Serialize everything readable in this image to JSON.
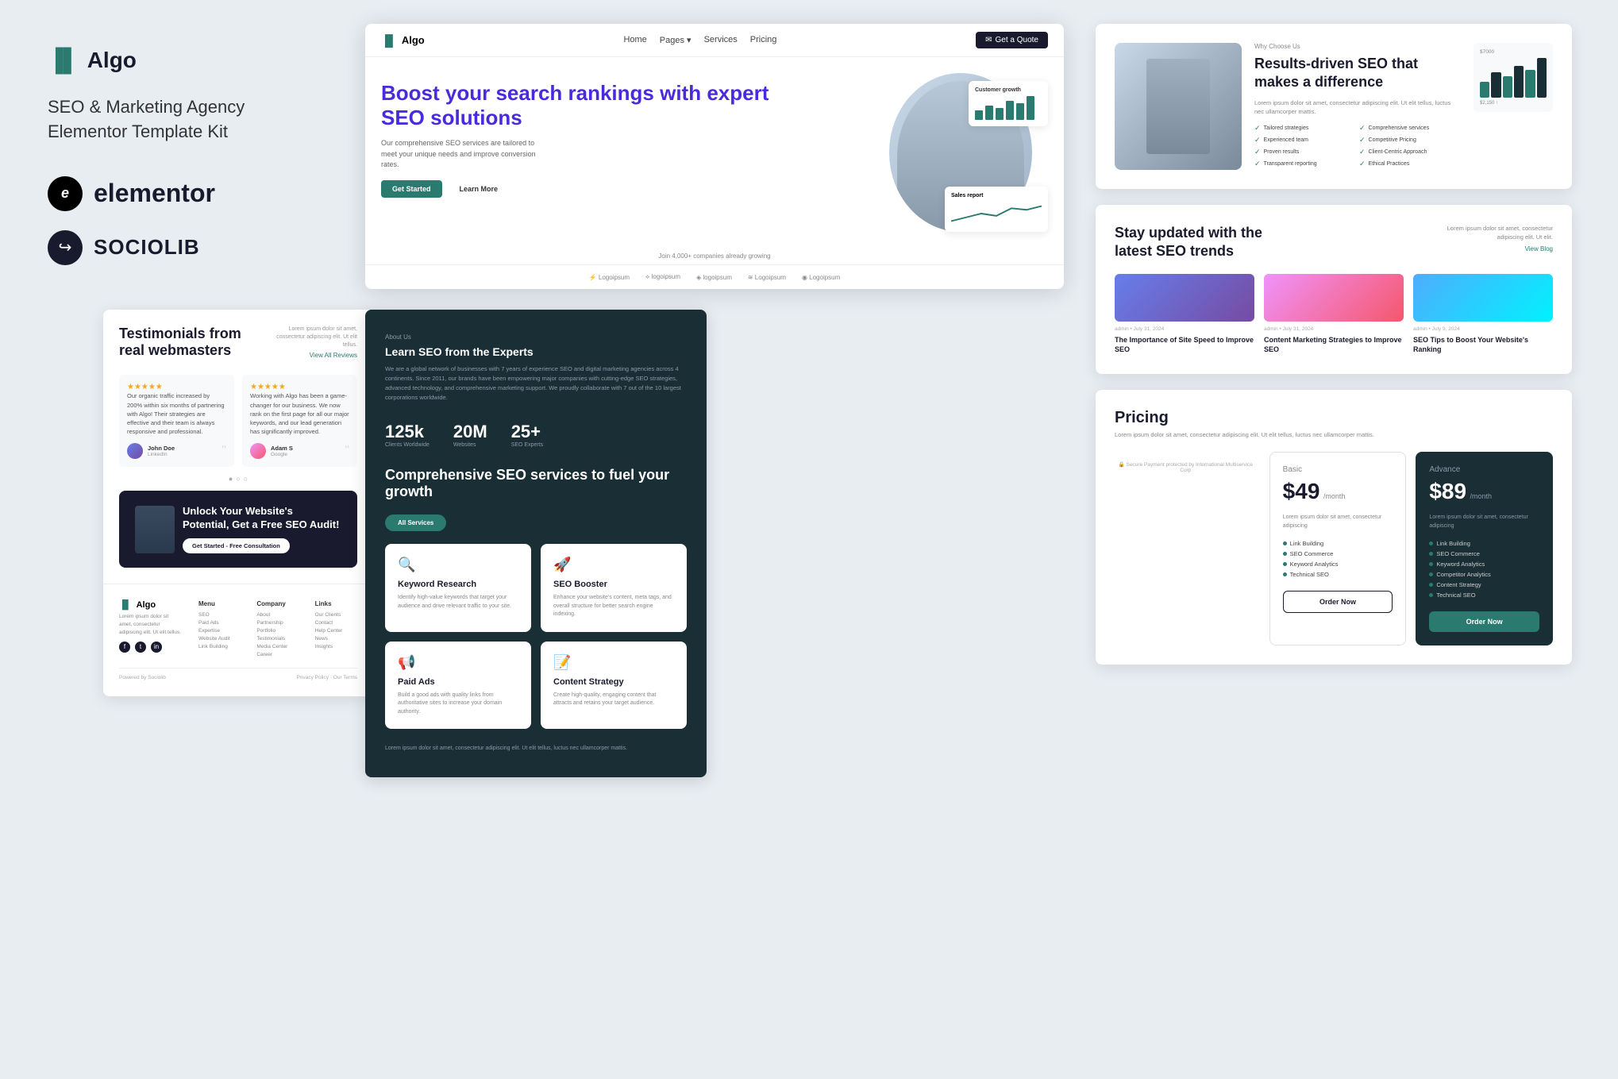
{
  "brand": {
    "name": "Algo",
    "tagline1": "SEO & Marketing Agency",
    "tagline2": "Elementor Template Kit"
  },
  "elementor": {
    "label": "elementor"
  },
  "sociolib": {
    "label": "SOCIOLIB"
  },
  "nav": {
    "logo": "Algo",
    "links": [
      "Home",
      "Pages",
      "Services",
      "Pricing"
    ],
    "cta": "Get a Quote"
  },
  "hero": {
    "heading": "Boost your search rankings with expert SEO solutions",
    "subtext": "Our comprehensive SEO services are tailored to meet your unique needs and improve conversion rates.",
    "btn_primary": "Get Started",
    "btn_secondary": "Learn More",
    "join_text": "Join 4,000+ companies already growing"
  },
  "why_us": {
    "label": "Why Choose Us",
    "heading": "Results-driven SEO that makes a difference",
    "desc": "Lorem ipsum dolor sit amet, consectetur adipiscing elit. Ut elit tellus, luctus nec ullamcorper mattis.",
    "features": [
      "Tailored strategies",
      "Comprehensive services",
      "Experienced team",
      "Competitive Pricing",
      "Proven results",
      "Client-Centric Approach",
      "Transparent reporting",
      "Ethical Practices"
    ]
  },
  "testimonials": {
    "heading": "Testimonials from real webmasters",
    "lorem": "Lorem ipsum dolor sit amet, consectetur adipiscing elit. Ut elit tellus.",
    "view_all": "View All Reviews",
    "cards": [
      {
        "text": "Our organic traffic increased by 200% within six months of partnering with Algo! Their strategies are effective and their team is always responsive and professional.",
        "author": "John Doe",
        "platform": "LinkedIn"
      },
      {
        "text": "Working with Algo has been a game-changer for our business. We now rank on the first page for all our major keywords, and our lead generation has significantly improved.",
        "author": "Adam S",
        "platform": "Google"
      }
    ]
  },
  "cta_banner": {
    "heading": "Unlock Your Website's Potential, Get a Free SEO Audit!",
    "btn": "Get Started - Free Consultation"
  },
  "services": {
    "about_label": "About Us",
    "heading": "Learn SEO from the Experts",
    "desc": "We are a global network of businesses with 7 years of experience SEO and digital marketing agencies across 4 continents. Since 2011, our brands have been empowering major companies with cutting-edge SEO strategies, advanced technology, and comprehensive marketing support. We proudly collaborate with 7 out of the 10 largest corporations worldwide.",
    "stats": [
      {
        "number": "125k",
        "label": "Clients Worldwide"
      },
      {
        "number": "20M",
        "label": "Websites"
      },
      {
        "number": "25+",
        "label": "SEO Experts"
      }
    ],
    "comprehensive_heading": "Comprehensive SEO services to fuel your growth",
    "all_services_btn": "All Services",
    "cards": [
      {
        "icon": "🔍",
        "title": "Keyword Research",
        "desc": "Identify high-value keywords that target your audience and drive relevant traffic to your site."
      },
      {
        "icon": "🚀",
        "title": "SEO Booster",
        "desc": "Enhance your website's content, meta tags, and overall structure for better search engine indexing."
      },
      {
        "icon": "📢",
        "title": "Paid Ads",
        "desc": "Build a good ads with quality links from authoritative sites to increase your domain authority."
      },
      {
        "icon": "📝",
        "title": "Content Strategy",
        "desc": "Create high-quality, engaging content that attracts and retains your target audience."
      }
    ],
    "footer_text": "Lorem ipsum dolor sit amet, consectetur adipiscing elit. Ut elit tellus, luctus nec ullamcorper mattis."
  },
  "blog": {
    "heading": "Stay updated with the latest SEO trends",
    "desc": "Lorem ipsum dolor sit amet, consectetur adipiscing elit. Ut elit.",
    "view_blog": "View Blog",
    "posts": [
      {
        "meta": "admin • July 31, 2024",
        "title": "The Importance of Site Speed to Improve SEO"
      },
      {
        "meta": "admin • July 31, 2024",
        "title": "Content Marketing Strategies to Improve SEO"
      },
      {
        "meta": "admin • July 9, 2024",
        "title": "SEO Tips to Boost Your Website's Ranking"
      }
    ]
  },
  "pricing": {
    "heading": "Pricing",
    "desc": "Lorem ipsum dolor sit amet, consectetur adipiscing elit. Ut elit tellus, luctus nec ullamcorper mattis.",
    "plans": [
      {
        "name": "Basic",
        "price": "$49",
        "period": "/month",
        "desc": "Lorem ipsum dolor sit amet, consectetur adipiscing",
        "features": [
          "Link Building",
          "SEO Commerce",
          "Keyword Analytics",
          "Technical SEO"
        ],
        "btn": "Order Now",
        "featured": false
      },
      {
        "name": "Advance",
        "price": "$89",
        "period": "/month",
        "desc": "Lorem ipsum dolor sit amet, consectetur adipiscing",
        "features": [
          "Link Building",
          "SEO Commerce",
          "Keyword Analytics",
          "Competitor Analytics",
          "Content Strategy",
          "Technical SEO"
        ],
        "btn": "Order Now",
        "featured": true
      }
    ],
    "secure_text": "Secure Payment protected by International Multiservice Corp"
  },
  "footer": {
    "brand": "Algo",
    "desc": "Lorem ipsum dolor sit amet, consectetur adipiscing elit. Ut elit tellus.",
    "columns": [
      {
        "title": "Menu",
        "links": [
          "SEO",
          "Paid Ads",
          "Expertise",
          "Website Audit",
          "Link Building"
        ]
      },
      {
        "title": "Company",
        "links": [
          "About",
          "Partnership",
          "Portfolio",
          "Testimonials",
          "Media Center",
          "Career"
        ]
      },
      {
        "title": "Links",
        "links": [
          "Our Clients",
          "Contact",
          "Help Center",
          "News",
          "Insights"
        ]
      }
    ],
    "powered_by": "Powered by Sociolib",
    "privacy": "Privacy Policy",
    "terms": "Our Terms"
  },
  "logos": [
    "Logoipsum",
    "logoipsum",
    "logoipsum",
    "Logoipsum",
    "Logoipsum"
  ]
}
